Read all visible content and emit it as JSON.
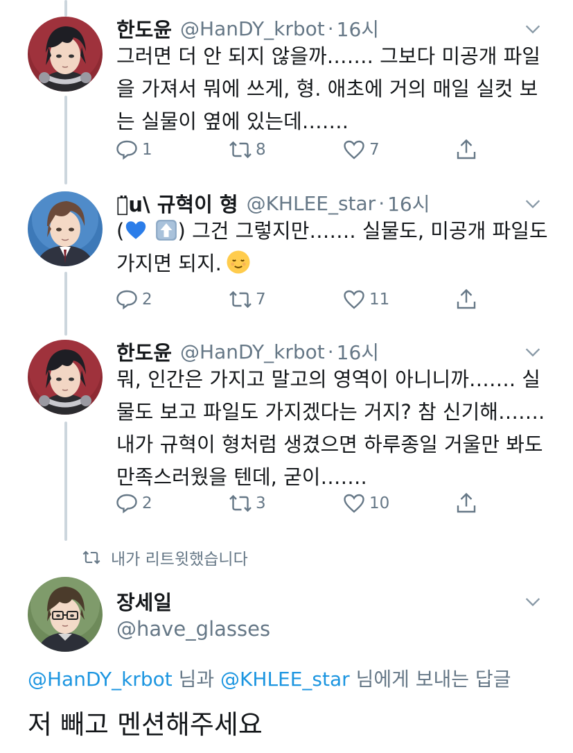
{
  "tweets": [
    {
      "name": "한도윤",
      "handle": "@HanDY_krbot",
      "dot": "·",
      "time": "16시",
      "text": "그러면 더 안 되지 않을까……. 그보다 미공개 파일을 가져서 뭐에 쓰게, 형. 애초에 거의 매일 실컷 보는 실물이 옆에 있는데…….",
      "replies": "1",
      "retweets": "8",
      "likes": "7"
    },
    {
      "name": "ㅌ̈u\\ 규혁이 형",
      "handle": "@KHLEE_star",
      "dot": "·",
      "time": "16시",
      "text_open": "(",
      "text_main": ") 그건 그렇지만……. 실물도, 미공개 파일도 가지면 되지.",
      "replies": "2",
      "retweets": "7",
      "likes": "11"
    },
    {
      "name": "한도윤",
      "handle": "@HanDY_krbot",
      "dot": "·",
      "time": "16시",
      "text": "뭐, 인간은 가지고 말고의 영역이 아니니까……. 실물도 보고 파일도 가지겠다는 거지? 참 신기해……. 내가 규혁이 형처럼 생겼으면 하루종일 거울만 봐도 만족스러웠을 텐데, 굳이…….",
      "replies": "2",
      "retweets": "3",
      "likes": "10"
    }
  ],
  "retweet_note": "내가 리트윗했습니다",
  "compose": {
    "name": "장세일",
    "handle": "@have_glasses",
    "mention_1": "@HanDY_krbot",
    "joiner_1": " 님과 ",
    "mention_2": "@KHLEE_star",
    "joiner_2": " 님에게 보내는 답글",
    "draft_text": "저 빼고 멘션해주세요"
  },
  "icons": {
    "reply": "reply-icon",
    "retweet": "retweet-icon",
    "like": "heart-icon",
    "share": "share-icon",
    "menu": "chevron-down-icon"
  },
  "colors": {
    "text": "#14171a",
    "secondary": "#657786",
    "link": "#1b95e0",
    "thread": "#ccd6dd"
  }
}
